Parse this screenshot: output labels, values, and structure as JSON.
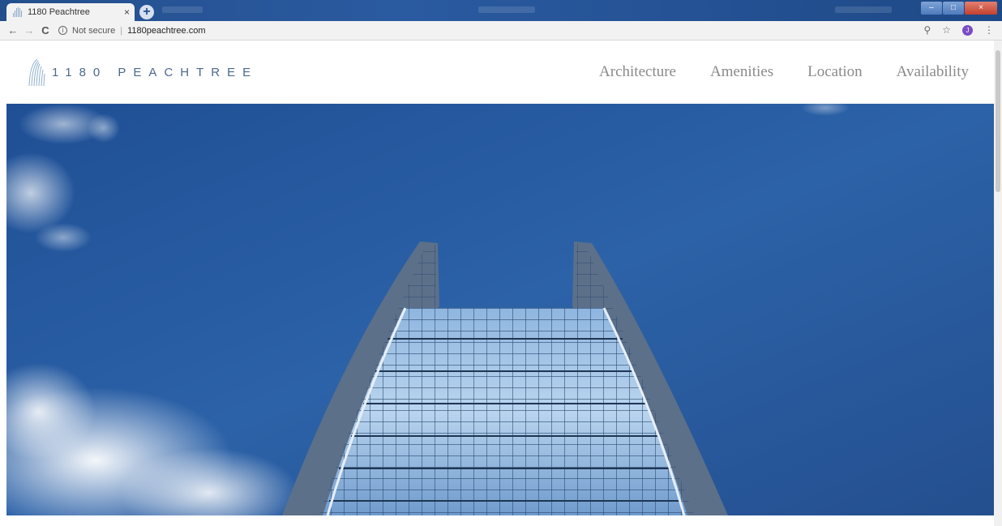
{
  "browser": {
    "tab_title": "1180 Peachtree",
    "tab_close": "×",
    "new_tab": "+",
    "address": {
      "security": "Not secure",
      "separator": "|",
      "url": "1180peachtree.com"
    },
    "icons": [
      "back-arrow-icon",
      "forward-arrow-icon",
      "reload-icon",
      "info-icon",
      "zoom-icon",
      "star-icon",
      "profile-icon",
      "menu-dots-icon"
    ],
    "profile_initial": "J",
    "window_controls": [
      "–",
      "□",
      "×"
    ]
  },
  "site": {
    "logo_text": "1180 PEACHTREE",
    "nav": [
      {
        "label": "Architecture"
      },
      {
        "label": "Amenities"
      },
      {
        "label": "Location"
      },
      {
        "label": "Availability"
      }
    ],
    "hero": {
      "description_icon": "tower-hero-image"
    },
    "colors": {
      "sky": "#2d5fa3",
      "logo": "#4b6a8d",
      "nav": "#8a8a8a"
    }
  }
}
